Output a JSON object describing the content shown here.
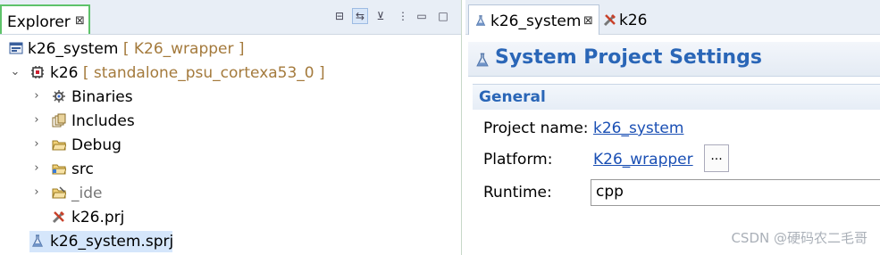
{
  "explorer": {
    "tab": {
      "label": "Explorer",
      "close": "⊠"
    },
    "toolbar": [
      {
        "name": "collapse-all-icon",
        "glyph": "⊟"
      },
      {
        "name": "link-with-editor-icon",
        "glyph": "⇆"
      },
      {
        "name": "filter-icon",
        "glyph": "⊻"
      },
      {
        "name": "view-menu-icon",
        "glyph": "⋮"
      },
      {
        "name": "minimize-icon",
        "glyph": "▭"
      },
      {
        "name": "maximize-icon",
        "glyph": "□"
      }
    ],
    "tree": [
      {
        "label": "k26_system",
        "decoration": " [ K26_wrapper ]",
        "icon": "system-project-icon"
      },
      {
        "label": "k26",
        "decoration": " [ standalone_psu_cortexa53_0 ]",
        "icon": "app-project-icon",
        "twisty": "⌄"
      },
      {
        "label": "Binaries",
        "icon": "binaries-icon",
        "twisty": "›"
      },
      {
        "label": "Includes",
        "icon": "includes-icon",
        "twisty": "›"
      },
      {
        "label": "Debug",
        "icon": "folder-icon",
        "twisty": "›"
      },
      {
        "label": "src",
        "icon": "folder-icon",
        "twisty": "›"
      },
      {
        "label": "_ide",
        "icon": "folder-icon",
        "twisty": "›"
      },
      {
        "label": "k26.prj",
        "icon": "prj-file-icon"
      },
      {
        "label": "k26_system.sprj",
        "icon": "sprj-file-icon"
      }
    ]
  },
  "editor": {
    "tabs": [
      {
        "label": "k26_system",
        "close": "⊠"
      },
      {
        "label": "k26"
      }
    ],
    "title": "System Project Settings",
    "section": "General",
    "fields": {
      "project_name_label": "Project name:",
      "project_name_value": "k26_system",
      "platform_label": "Platform:",
      "platform_value": "K26_wrapper",
      "browse_label": "...",
      "runtime_label": "Runtime:",
      "runtime_value": "cpp"
    }
  },
  "watermark": "CSDN @硬码农二毛哥",
  "colors": {
    "accent": "#2a66b7",
    "link": "#1a4fb4",
    "selection": "#d5e6fb",
    "active_tab_border": "#5ec26a",
    "decoration": "#a47a3c"
  }
}
